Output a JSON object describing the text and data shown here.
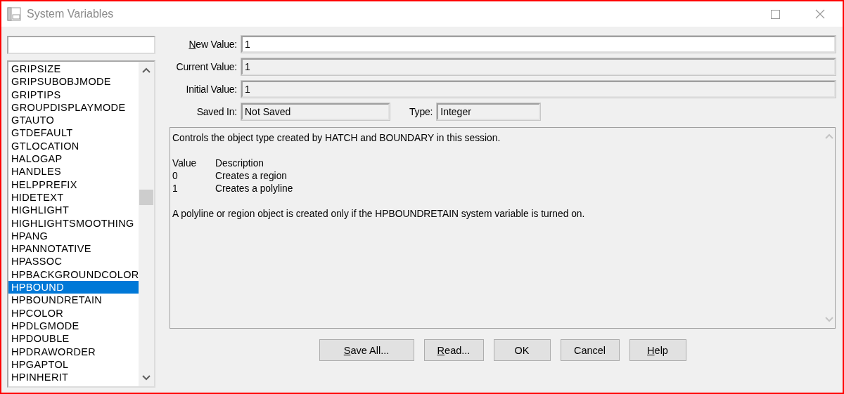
{
  "window": {
    "title": "System Variables"
  },
  "variables": [
    {
      "name": "GRIPSIZE",
      "selected": false
    },
    {
      "name": "GRIPSUBOBJMODE",
      "selected": false
    },
    {
      "name": "GRIPTIPS",
      "selected": false
    },
    {
      "name": "GROUPDISPLAYMODE",
      "selected": false
    },
    {
      "name": "GTAUTO",
      "selected": false
    },
    {
      "name": "GTDEFAULT",
      "selected": false
    },
    {
      "name": "GTLOCATION",
      "selected": false
    },
    {
      "name": "HALOGAP",
      "selected": false
    },
    {
      "name": "HANDLES",
      "selected": false
    },
    {
      "name": "HELPPREFIX",
      "selected": false
    },
    {
      "name": "HIDETEXT",
      "selected": false
    },
    {
      "name": "HIGHLIGHT",
      "selected": false
    },
    {
      "name": "HIGHLIGHTSMOOTHING",
      "selected": false
    },
    {
      "name": "HPANG",
      "selected": false
    },
    {
      "name": "HPANNOTATIVE",
      "selected": false
    },
    {
      "name": "HPASSOC",
      "selected": false
    },
    {
      "name": "HPBACKGROUNDCOLOR",
      "selected": false
    },
    {
      "name": "HPBOUND",
      "selected": true
    },
    {
      "name": "HPBOUNDRETAIN",
      "selected": false
    },
    {
      "name": "HPCOLOR",
      "selected": false
    },
    {
      "name": "HPDLGMODE",
      "selected": false
    },
    {
      "name": "HPDOUBLE",
      "selected": false
    },
    {
      "name": "HPDRAWORDER",
      "selected": false
    },
    {
      "name": "HPGAPTOL",
      "selected": false
    },
    {
      "name": "HPINHERIT",
      "selected": false
    }
  ],
  "fields": [
    {
      "kind": "input",
      "label": "New Value:",
      "mnemonic": true,
      "value": "1"
    },
    {
      "kind": "readonly",
      "label": "Current Value:",
      "value": "1"
    },
    {
      "kind": "readonly",
      "label": "Initial Value:",
      "value": "1"
    }
  ],
  "info": [
    {
      "label": "Saved In:",
      "value": "Not Saved"
    },
    {
      "label": "Type:",
      "value": "Integer"
    }
  ],
  "description": {
    "intro": "Controls the object type created by HATCH and BOUNDARY in this session.",
    "table": {
      "columns": [
        "Value",
        "Description"
      ],
      "rows": [
        [
          "0",
          "Creates a region"
        ],
        [
          "1",
          "Creates a polyline"
        ]
      ]
    },
    "note": "A polyline or region object is created only if the HPBOUNDRETAIN system variable is turned on."
  },
  "buttons": [
    {
      "label": "Save All...",
      "mnemonic": true
    },
    {
      "label": "Read...",
      "mnemonic": true
    },
    {
      "label": "OK"
    },
    {
      "label": "Cancel"
    },
    {
      "label": "Help",
      "mnemonic": true
    }
  ]
}
